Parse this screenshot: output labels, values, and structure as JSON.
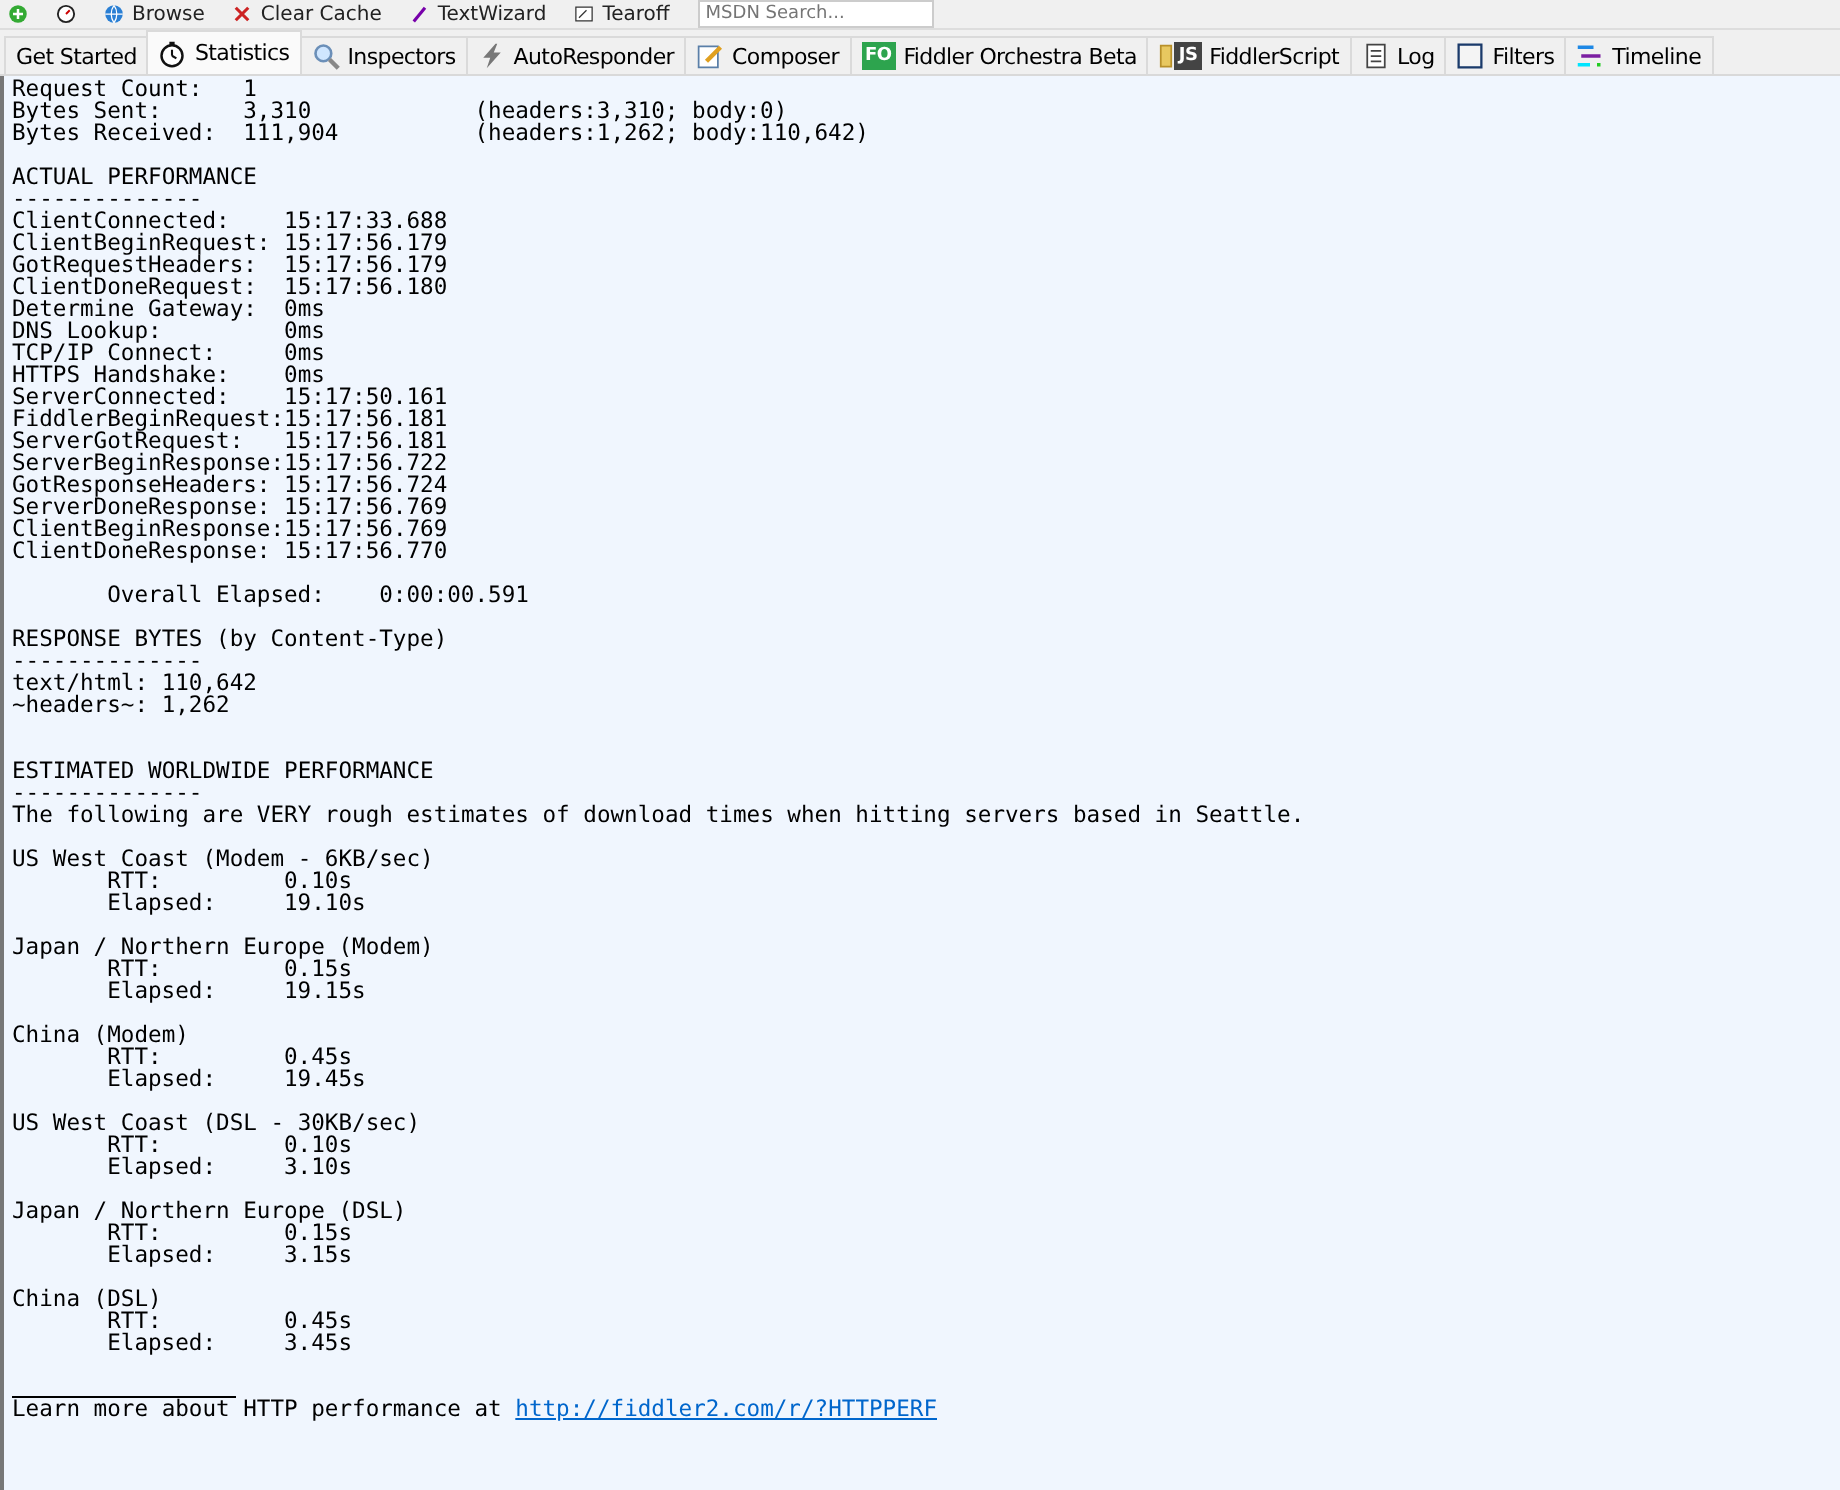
{
  "toolbar": {
    "items": [
      {
        "kind": "plus"
      },
      {
        "kind": "timer"
      },
      {
        "kind": "browse",
        "label": "Browse"
      },
      {
        "kind": "clear",
        "label": "Clear Cache"
      },
      {
        "kind": "wand",
        "label": "TextWizard"
      },
      {
        "kind": "tearoff",
        "label": "Tearoff"
      }
    ],
    "search": {
      "placeholder": "MSDN Search..."
    }
  },
  "tabs": [
    {
      "label": "Get Started",
      "kind": "plain",
      "selected": false
    },
    {
      "label": "Statistics",
      "kind": "stopwatch",
      "selected": true
    },
    {
      "label": "Inspectors",
      "kind": "magnifier",
      "selected": false
    },
    {
      "label": "AutoResponder",
      "kind": "bolt",
      "selected": false
    },
    {
      "label": "Composer",
      "kind": "pencil",
      "selected": false
    },
    {
      "label": "Fiddler Orchestra Beta",
      "kind": "badge",
      "badge": "FO",
      "selected": false
    },
    {
      "label": "FiddlerScript",
      "kind": "scroll",
      "badge": "JS",
      "selected": false
    },
    {
      "label": "Log",
      "kind": "document",
      "selected": false
    },
    {
      "label": "Filters",
      "kind": "checkbox",
      "selected": false
    },
    {
      "label": "Timeline",
      "kind": "bars",
      "selected": false
    }
  ],
  "summary": [
    {
      "label": "Request Count:",
      "value": "1"
    },
    {
      "label": "Bytes Sent:",
      "value": "3,310",
      "detail": "(headers:3,310; body:0)"
    },
    {
      "label": "Bytes Received:",
      "value": "111,904",
      "detail": "(headers:1,262; body:110,642)"
    }
  ],
  "actual_performance": {
    "heading": "ACTUAL PERFORMANCE",
    "rule": "--------------",
    "rows": [
      {
        "label": "ClientConnected:",
        "value": "15:17:33.688"
      },
      {
        "label": "ClientBeginRequest:",
        "value": "15:17:56.179"
      },
      {
        "label": "GotRequestHeaders:",
        "value": "15:17:56.179"
      },
      {
        "label": "ClientDoneRequest:",
        "value": "15:17:56.180"
      },
      {
        "label": "Determine Gateway:",
        "value": "0ms"
      },
      {
        "label": "DNS Lookup:",
        "value": "0ms"
      },
      {
        "label": "TCP/IP Connect:",
        "value": "0ms"
      },
      {
        "label": "HTTPS Handshake:",
        "value": "0ms"
      },
      {
        "label": "ServerConnected:",
        "value": "15:17:50.161"
      },
      {
        "label": "FiddlerBeginRequest:",
        "value": "15:17:56.181"
      },
      {
        "label": "ServerGotRequest:",
        "value": "15:17:56.181"
      },
      {
        "label": "ServerBeginResponse:",
        "value": "15:17:56.722"
      },
      {
        "label": "GotResponseHeaders:",
        "value": "15:17:56.724"
      },
      {
        "label": "ServerDoneResponse:",
        "value": "15:17:56.769"
      },
      {
        "label": "ClientBeginResponse:",
        "value": "15:17:56.769"
      },
      {
        "label": "ClientDoneResponse:",
        "value": "15:17:56.770"
      }
    ],
    "overall": {
      "label": "Overall Elapsed:",
      "value": "0:00:00.591"
    }
  },
  "response_bytes": {
    "heading": "RESPONSE BYTES (by Content-Type)",
    "rule": "--------------",
    "rows": [
      {
        "text": "text/html: 110,642"
      },
      {
        "text": "~headers~: 1,262"
      }
    ]
  },
  "worldwide": {
    "heading": "ESTIMATED WORLDWIDE PERFORMANCE",
    "rule": "--------------",
    "intro": "The following are VERY rough estimates of download times when hitting servers based in Seattle.",
    "regions": [
      {
        "name": "US West Coast (Modem - 6KB/sec)",
        "rtt_label": "RTT:",
        "rtt": "0.10s",
        "elapsed_label": "Elapsed:",
        "elapsed": "19.10s"
      },
      {
        "name": "Japan / Northern Europe (Modem)",
        "rtt_label": "RTT:",
        "rtt": "0.15s",
        "elapsed_label": "Elapsed:",
        "elapsed": "19.15s"
      },
      {
        "name": "China (Modem)",
        "rtt_label": "RTT:",
        "rtt": "0.45s",
        "elapsed_label": "Elapsed:",
        "elapsed": "19.45s"
      },
      {
        "name": "US West Coast (DSL - 30KB/sec)",
        "rtt_label": "RTT:",
        "rtt": "0.10s",
        "elapsed_label": "Elapsed:",
        "elapsed": "3.10s"
      },
      {
        "name": "Japan / Northern Europe (DSL)",
        "rtt_label": "RTT:",
        "rtt": "0.15s",
        "elapsed_label": "Elapsed:",
        "elapsed": "3.15s"
      },
      {
        "name": "China (DSL)",
        "rtt_label": "RTT:",
        "rtt": "0.45s",
        "elapsed_label": "Elapsed:",
        "elapsed": "3.45s"
      }
    ]
  },
  "footer": {
    "text": "Learn more about HTTP performance at",
    "link": "http://fiddler2.com/r/?HTTPPERF"
  }
}
